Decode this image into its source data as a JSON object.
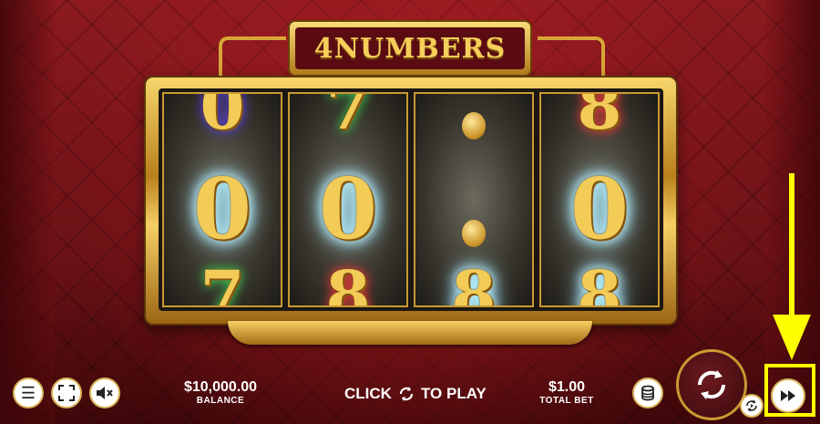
{
  "game": {
    "logo_text": "4NUMBERS"
  },
  "reels": [
    {
      "top": "0",
      "middle": "0",
      "bottom": "7"
    },
    {
      "top": "7",
      "middle": "0",
      "bottom": "8"
    },
    {
      "top": "",
      "middle": "",
      "bottom": "8"
    },
    {
      "top": "8",
      "middle": "0",
      "bottom": "8"
    }
  ],
  "controls": {
    "balance_value": "$10,000.00",
    "balance_label": "BALANCE",
    "click_text_before": "CLICK",
    "click_text_after": "TO PLAY",
    "total_bet_value": "$1.00",
    "total_bet_label": "TOTAL BET"
  },
  "icons": {
    "menu": "menu-icon",
    "fullscreen": "fullscreen-icon",
    "sound": "mute-icon",
    "coins": "coins-icon",
    "spin": "spin-icon",
    "autoplay": "autoplay-icon",
    "turbo": "fast-forward-icon"
  },
  "colors": {
    "gold": "#f3cb57",
    "highlight": "#ffff00",
    "background": "#6b1216"
  }
}
